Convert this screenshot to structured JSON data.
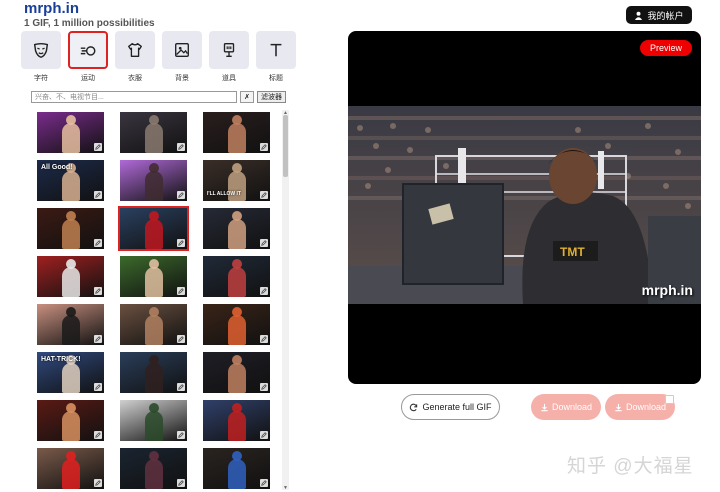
{
  "header": {
    "title": "mrph.in",
    "tagline": "1 GIF, 1 million possibilities",
    "account_label": "我的帐户"
  },
  "categories": [
    {
      "label": "字符",
      "icon": "mask-icon"
    },
    {
      "label": "运动",
      "icon": "motion-icon",
      "active": true
    },
    {
      "label": "衣服",
      "icon": "shirt-icon"
    },
    {
      "label": "背景",
      "icon": "image-icon"
    },
    {
      "label": "道具",
      "icon": "prop-icon"
    },
    {
      "label": "标题",
      "icon": "text-icon"
    }
  ],
  "search": {
    "placeholder": "兴奋、不、电视节目...",
    "clear_label": "✗",
    "filter_label": "滤波器"
  },
  "gifs": [
    {
      "bg": "#7a2c8c",
      "fg": "#e8c0a0",
      "text": ""
    },
    {
      "bg": "#3a3540",
      "fg": "#8a7a70",
      "text": ""
    },
    {
      "bg": "#2a1e1e",
      "fg": "#c08060",
      "text": ""
    },
    {
      "bg": "#1c2a4a",
      "fg": "#d8b090",
      "text": "All Good!"
    },
    {
      "bg": "#b06ad8",
      "fg": "#402c30",
      "text": ""
    },
    {
      "bg": "#3a2e28",
      "fg": "#c0a080",
      "text": "I'LL ALLOW IT"
    },
    {
      "bg": "#3c1a14",
      "fg": "#c08050",
      "text": ""
    },
    {
      "bg": "#2a4060",
      "fg": "#c01820",
      "text": "",
      "selected": true
    },
    {
      "bg": "#262a36",
      "fg": "#d0a080",
      "text": ""
    },
    {
      "bg": "#a02020",
      "fg": "#e8e8e8",
      "text": ""
    },
    {
      "bg": "#3c6a2c",
      "fg": "#e0c0a0",
      "text": ""
    },
    {
      "bg": "#202a38",
      "fg": "#c04040",
      "text": ""
    },
    {
      "bg": "#c89080",
      "fg": "#1a1a1a",
      "text": ""
    },
    {
      "bg": "#6a5040",
      "fg": "#b08060",
      "text": ""
    },
    {
      "bg": "#3a2418",
      "fg": "#e06030",
      "text": ""
    },
    {
      "bg": "#304a80",
      "fg": "#e0d0c0",
      "text": "HAT-TRICK!"
    },
    {
      "bg": "#2a3e5a",
      "fg": "#302020",
      "text": ""
    },
    {
      "bg": "#1e1e26",
      "fg": "#c08060",
      "text": ""
    },
    {
      "bg": "#5a1a14",
      "fg": "#d89060",
      "text": ""
    },
    {
      "bg": "#d0d0d0",
      "fg": "#2a4a2a",
      "text": ""
    },
    {
      "bg": "#30406a",
      "fg": "#c02020",
      "text": ""
    },
    {
      "bg": "#7a5a4a",
      "fg": "#e02020",
      "text": ""
    },
    {
      "bg": "#1a2430",
      "fg": "#603040",
      "text": ""
    },
    {
      "bg": "#2a2420",
      "fg": "#3060c0",
      "text": ""
    }
  ],
  "preview": {
    "badge": "Preview",
    "watermark": "mrph.in"
  },
  "actions": {
    "generate_label": "Generate full GIF",
    "download_label": "Download",
    "download2_label": "Download"
  },
  "site_watermark": "知乎 @大福星"
}
